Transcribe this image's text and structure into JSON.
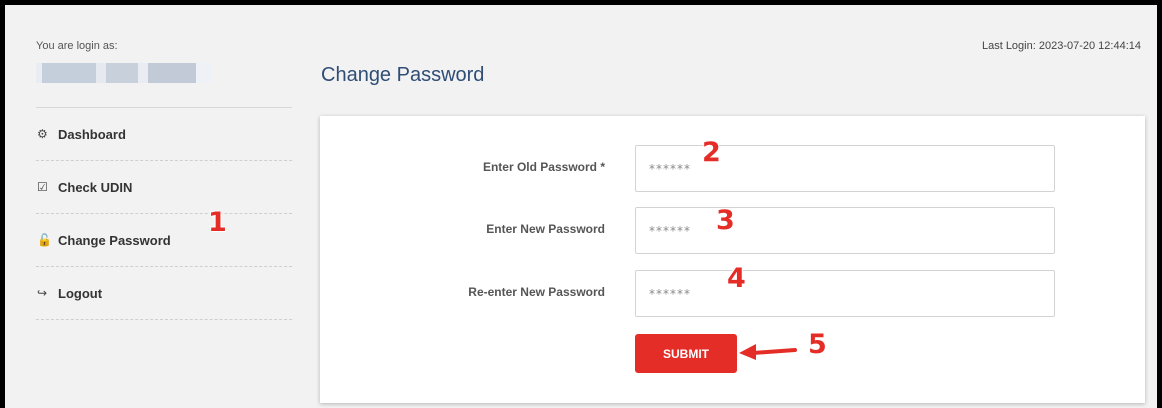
{
  "sidebar": {
    "login_as": "You are login as:",
    "items": [
      {
        "label": "Dashboard",
        "icon": "dashboard-icon",
        "glyph": "⚙"
      },
      {
        "label": "Check UDIN",
        "icon": "check-icon",
        "glyph": "☑"
      },
      {
        "label": "Change Password",
        "icon": "lock-icon",
        "glyph": "🔓"
      },
      {
        "label": "Logout",
        "icon": "logout-icon",
        "glyph": "↪"
      }
    ]
  },
  "header": {
    "last_login": "Last Login: 2023-07-20 12:44:14",
    "title": "Change Password"
  },
  "form": {
    "old_password": {
      "label": "Enter Old Password *",
      "placeholder": "******"
    },
    "new_password": {
      "label": "Enter New Password",
      "placeholder": "******"
    },
    "confirm_password": {
      "label": "Re-enter New Password",
      "placeholder": "******"
    },
    "submit_label": "SUBMIT"
  },
  "annotations": [
    "1",
    "2",
    "3",
    "4",
    "5"
  ],
  "colors": {
    "accent": "#e52d27",
    "title": "#2f4d75",
    "background": "#f2f2f2"
  }
}
